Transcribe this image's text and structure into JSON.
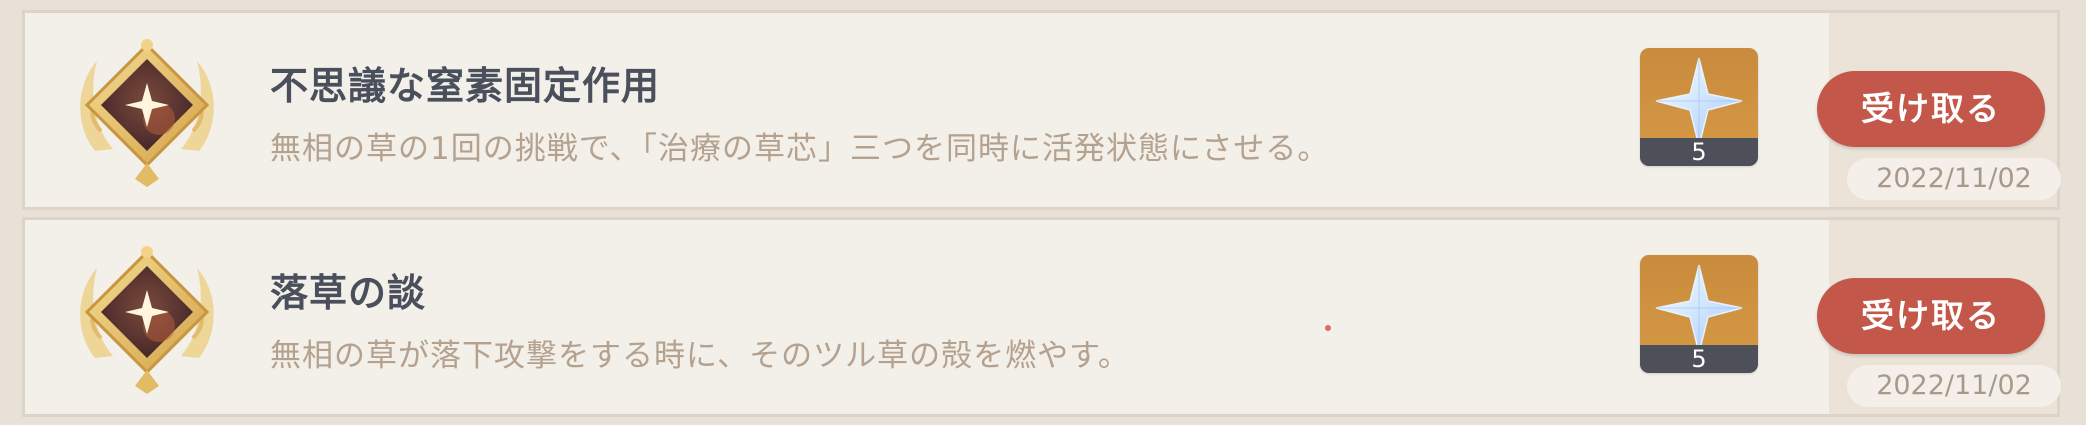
{
  "achievements": [
    {
      "title": "不思議な窒素固定作用",
      "description": "無相の草の1回の挑戦で、「治療の草芯」三つを同時に活発状態にさせる。",
      "reward_icon": "primogem-icon",
      "reward_count": "5",
      "claim_label": "受け取る",
      "date": "2022/11/02"
    },
    {
      "title": "落草の談",
      "description": "無相の草が落下攻撃をする時に、そのツル草の殻を燃やす。",
      "reward_icon": "primogem-icon",
      "reward_count": "5",
      "claim_label": "受け取る",
      "date": "2022/11/02"
    }
  ],
  "colors": {
    "claim_button": "#c2574a",
    "title_text": "#4a4f5c",
    "description_text": "#b4a28f",
    "card_background": "#f3efe9"
  }
}
